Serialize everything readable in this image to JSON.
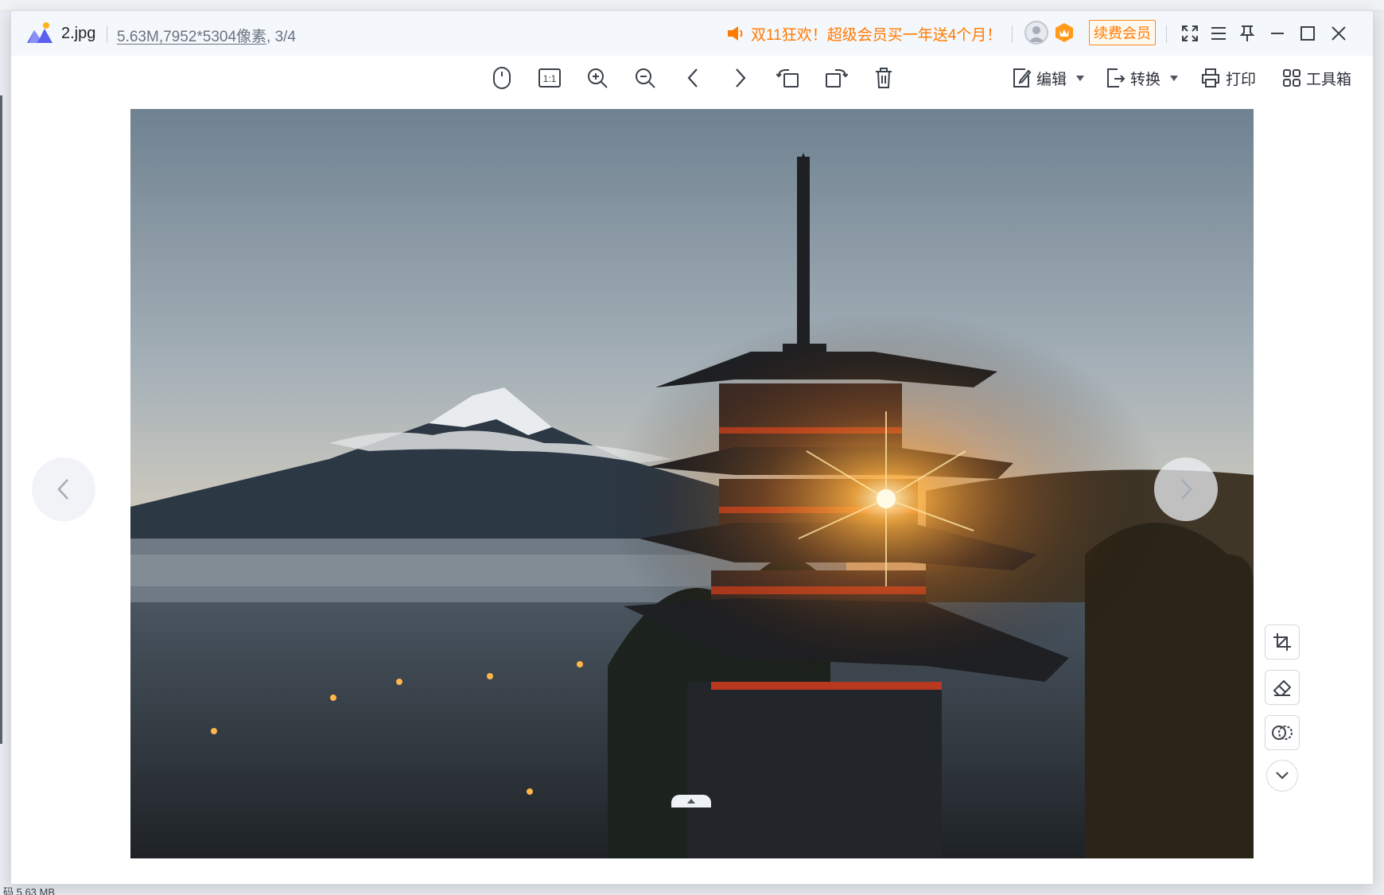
{
  "window": {
    "file_name": "2.jpg",
    "file_size": "5.63M",
    "dimensions": ",7952*5304像素",
    "page_index": ", 3/4"
  },
  "promo": {
    "text": "双11狂欢！超级会员买一年送4个月！"
  },
  "account": {
    "renew_label": "续费会员"
  },
  "toolbar": {
    "edit_label": "编辑",
    "convert_label": "转换",
    "print_label": "打印",
    "toolbox_label": "工具箱"
  },
  "icons": {
    "mouse": "mouse-icon",
    "actual_size": "actual-size-icon",
    "zoom_in": "zoom-in-icon",
    "zoom_out": "zoom-out-icon",
    "prev": "chevron-left-icon",
    "next": "chevron-right-icon",
    "rotate_left": "rotate-left-icon",
    "rotate_right": "rotate-right-icon",
    "delete": "trash-icon",
    "crop": "crop-icon",
    "eraser": "eraser-icon",
    "compare": "compare-icon",
    "expand_down": "chevron-down-icon"
  },
  "actual_size_label": "1:1",
  "status_bar": {
    "text": "码  5.63 MB"
  },
  "colors": {
    "accent_orange": "#ff7a00",
    "titlebar_bg": "#f4f7fb",
    "icon_gray": "#3c424b"
  }
}
